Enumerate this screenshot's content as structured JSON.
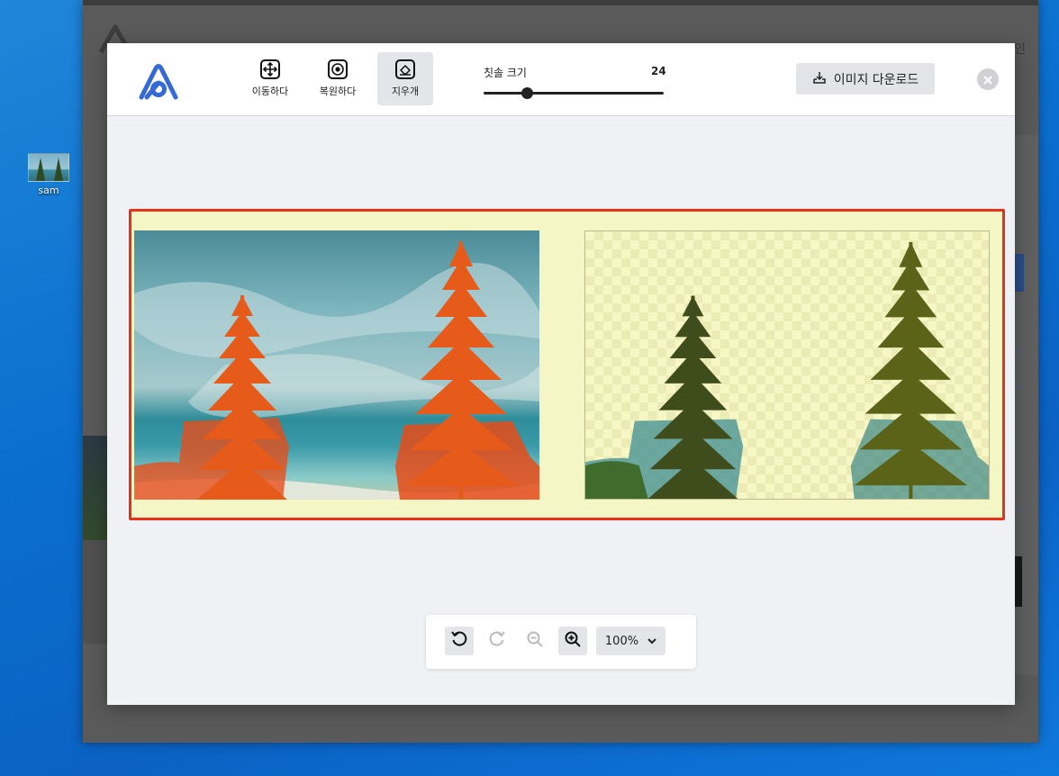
{
  "desktop": {
    "icon_label": "sam"
  },
  "background_window": {
    "right_text": "인"
  },
  "toolbar": {
    "tools": [
      {
        "label": "이동하다",
        "icon": "move-icon"
      },
      {
        "label": "복원하다",
        "icon": "restore-icon"
      },
      {
        "label": "지우개",
        "icon": "eraser-icon"
      }
    ],
    "active_tool": "지우개",
    "brush": {
      "label": "칫솔 크기",
      "value": "24",
      "fraction": 0.24
    },
    "download_label": "이미지 다운로드"
  },
  "zoom": {
    "level": "100%"
  },
  "colors": {
    "accent": "#3569d4",
    "canvas_border": "#e8311a",
    "canvas_background": "#f5f6c5",
    "highlight": "#e84b17"
  }
}
